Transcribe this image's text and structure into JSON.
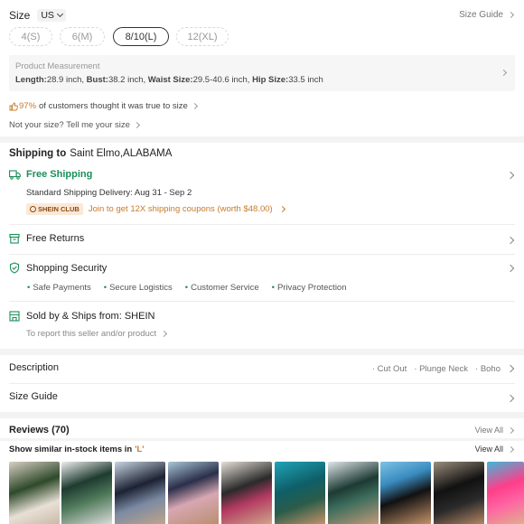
{
  "size": {
    "label": "Size",
    "region": "US",
    "guide_link": "Size Guide",
    "options": [
      "4(S)",
      "6(M)",
      "8/10(L)",
      "12(XL)"
    ],
    "selected": "8/10(L)"
  },
  "measurement": {
    "title": "Product Measurement",
    "length_label": "Length:",
    "length_val": "28.9 inch,",
    "bust_label": "Bust:",
    "bust_val": "38.2 inch,",
    "waist_label": "Waist Size:",
    "waist_val": "29.5-40.6 inch,",
    "hip_label": "Hip Size:",
    "hip_val": "33.5 inch"
  },
  "fit": {
    "percent": "97%",
    "text": "of customers thought it was true to size",
    "not_your_size": "Not your size? Tell me your size"
  },
  "shipping": {
    "prefix": "Shipping to",
    "location": "Saint Elmo,ALABAMA",
    "free_shipping": "Free Shipping",
    "delivery": "Standard Shipping Delivery: Aug 31 - Sep 2",
    "club_badge": "SHEIN CLUB",
    "club_text": "Join to get 12X shipping coupons (worth $48.00)",
    "free_returns": "Free Returns",
    "security": "Shopping Security",
    "security_items": [
      "Safe Payments",
      "Secure Logistics",
      "Customer Service",
      "Privacy Protection"
    ],
    "sold_by": "Sold by & Ships from: SHEIN",
    "report": "To report this seller and/or product"
  },
  "description": {
    "label": "Description",
    "tags": [
      "Cut Out",
      "Plunge Neck",
      "Boho"
    ]
  },
  "size_guide": {
    "label": "Size Guide"
  },
  "reviews": {
    "label": "Reviews (70)",
    "view_all": "View All"
  },
  "similar": {
    "prefix": "Show similar in-stock items in",
    "size": "'L'",
    "view_all": "View All"
  },
  "colors": {
    "green": "#1a8f5a",
    "orange": "#c87a2a",
    "club_bg": "#fbe8d6"
  }
}
